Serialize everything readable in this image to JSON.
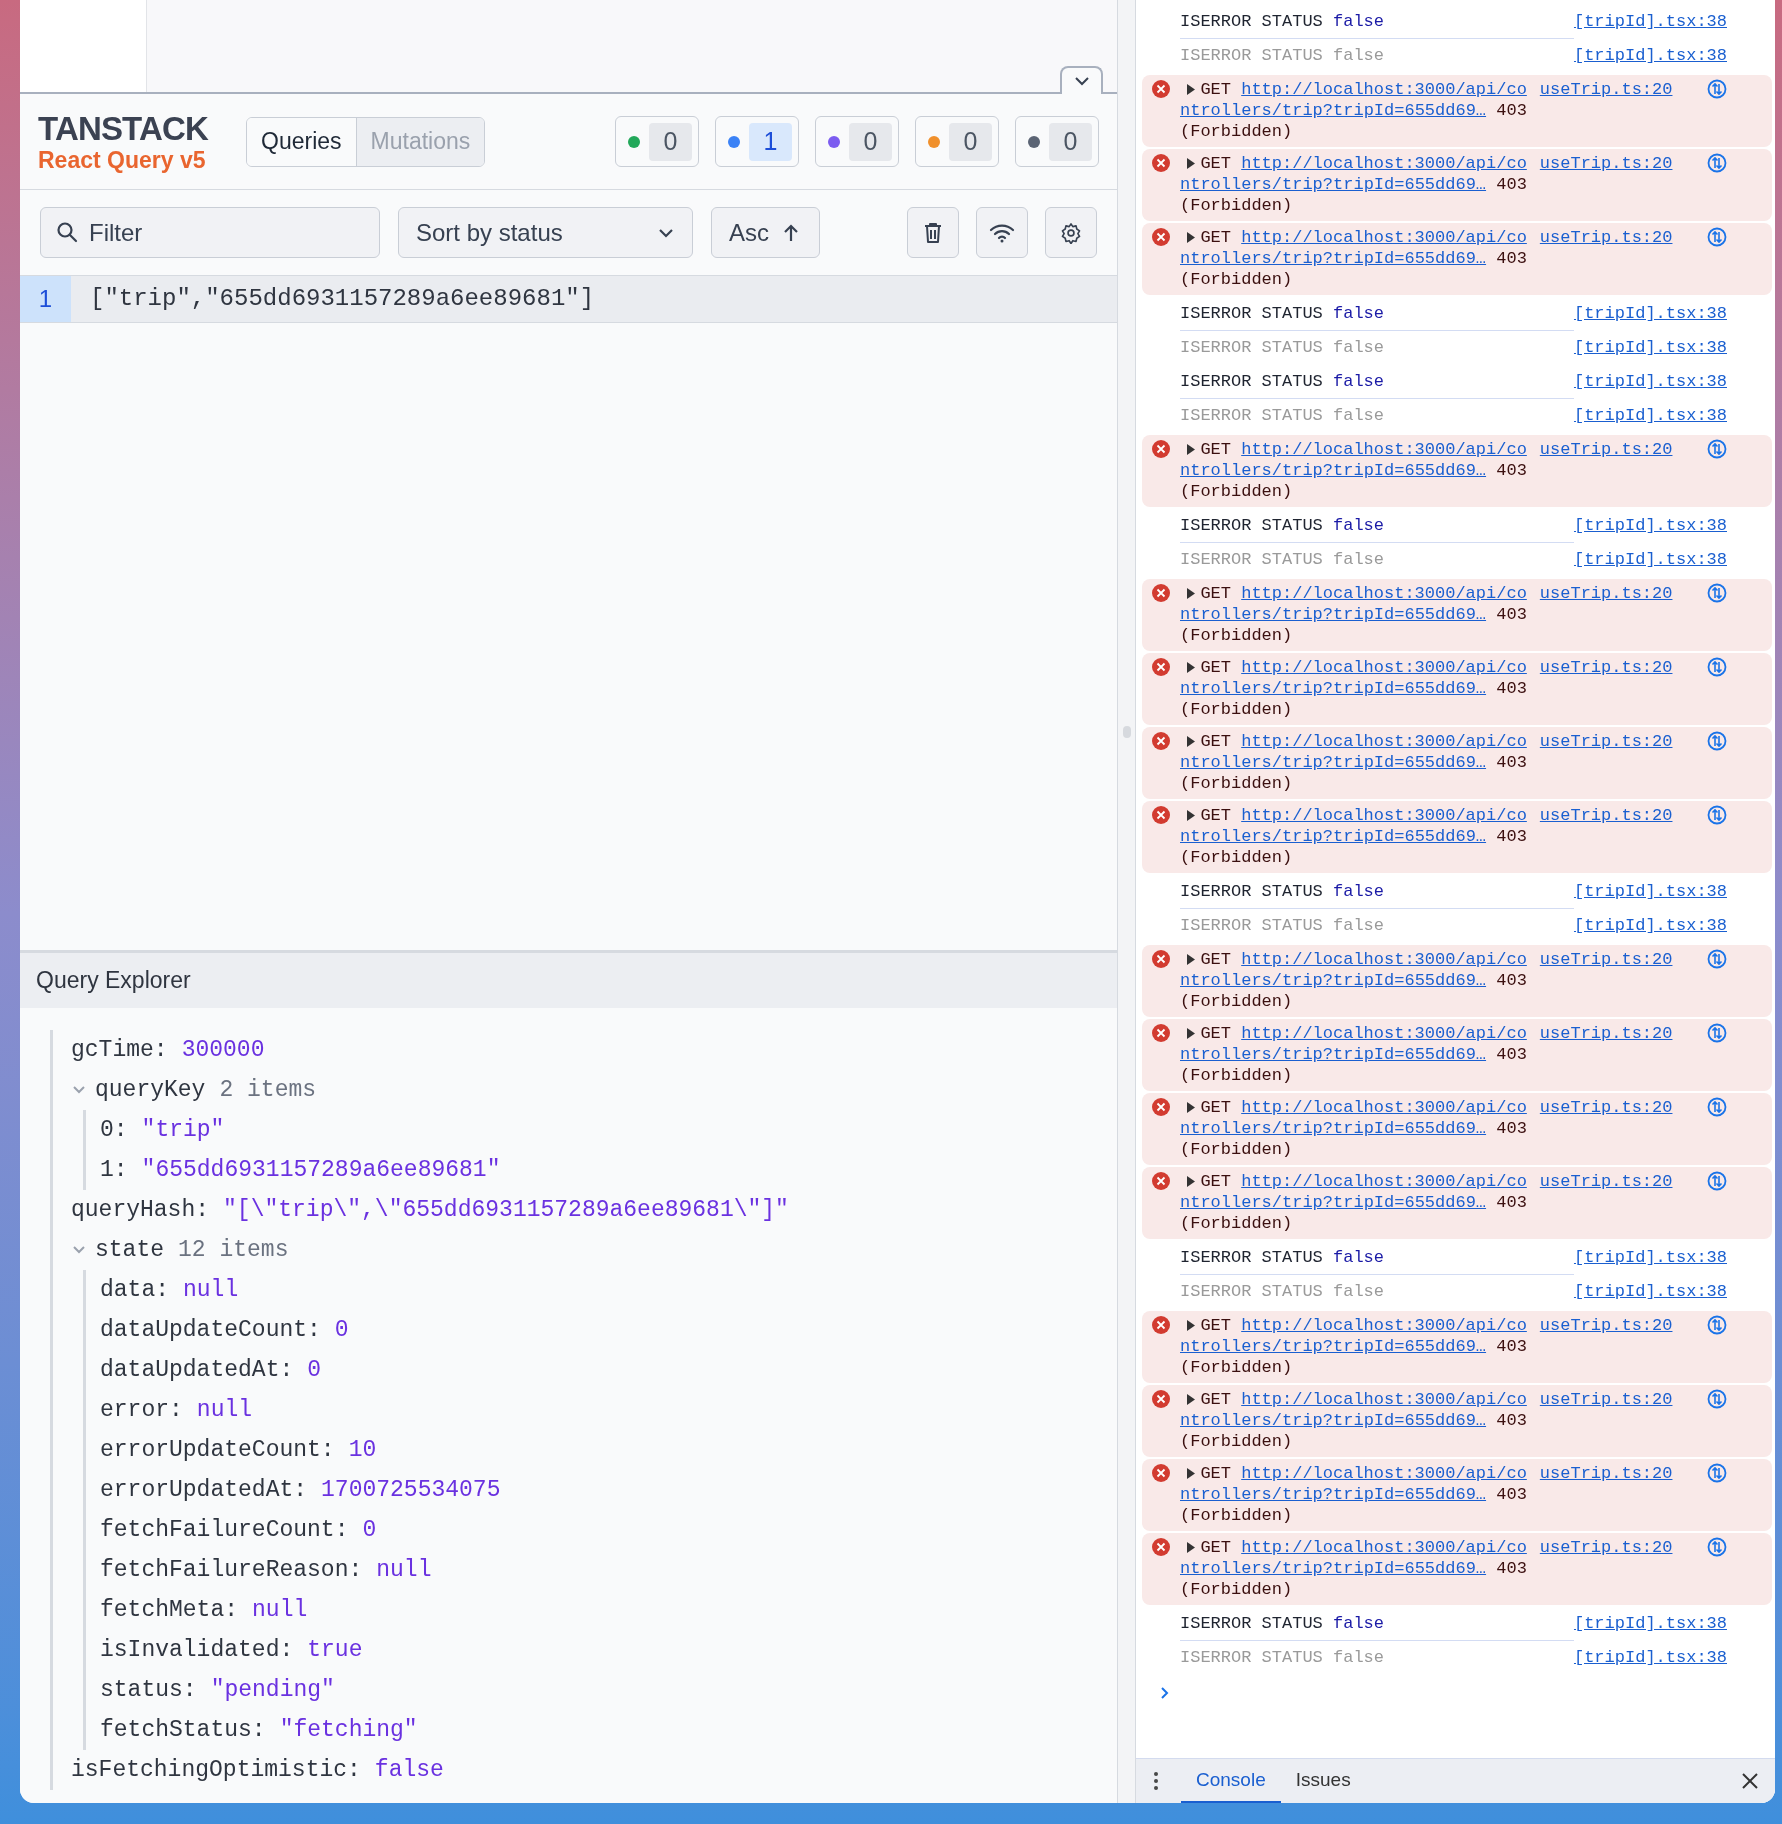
{
  "devtools": {
    "brand": "TANSTACK",
    "subtitle": "React Query v5",
    "tabs": [
      {
        "label": "Queries",
        "selected": true
      },
      {
        "label": "Mutations",
        "selected": false
      }
    ],
    "status_counts": [
      {
        "count": "0",
        "color": "#22a85a",
        "active": false
      },
      {
        "count": "1",
        "color": "#3b82f6",
        "active": true
      },
      {
        "count": "0",
        "color": "#7c5cf0",
        "active": false
      },
      {
        "count": "0",
        "color": "#f0902c",
        "active": false
      },
      {
        "count": "0",
        "color": "#5b6474",
        "active": false
      }
    ],
    "filter": {
      "placeholder": "Filter"
    },
    "sort": {
      "value": "Sort by status"
    },
    "order": {
      "label": "Asc"
    },
    "queries": [
      {
        "index": "1",
        "key": "[\"trip\",\"655dd6931157289a6ee89681\"]",
        "selected": true
      }
    ]
  },
  "query_explorer": {
    "title": "Query Explorer",
    "entries": [
      {
        "key": "gcTime:",
        "value": "300000"
      },
      {
        "key": "queryKey",
        "count": "2 items",
        "expanded": true,
        "children": [
          {
            "key": "0:",
            "value": "\"trip\""
          },
          {
            "key": "1:",
            "value": "\"655dd6931157289a6ee89681\""
          }
        ]
      },
      {
        "key": "queryHash:",
        "value": "\"[\\\"trip\\\",\\\"655dd6931157289a6ee89681\\\"]\""
      },
      {
        "key": "state",
        "count": "12 items",
        "expanded": true,
        "children": [
          {
            "key": "data:",
            "value": "null"
          },
          {
            "key": "dataUpdateCount:",
            "value": "0"
          },
          {
            "key": "dataUpdatedAt:",
            "value": "0"
          },
          {
            "key": "error:",
            "value": "null"
          },
          {
            "key": "errorUpdateCount:",
            "value": "10"
          },
          {
            "key": "errorUpdatedAt:",
            "value": "1700725534075"
          },
          {
            "key": "fetchFailureCount:",
            "value": "0"
          },
          {
            "key": "fetchFailureReason:",
            "value": "null"
          },
          {
            "key": "fetchMeta:",
            "value": "null"
          },
          {
            "key": "isInvalidated:",
            "value": "true"
          },
          {
            "key": "status:",
            "value": "\"pending\""
          },
          {
            "key": "fetchStatus:",
            "value": "\"fetching\""
          }
        ]
      },
      {
        "key": "isFetchingOptimistic:",
        "value": "false"
      }
    ]
  },
  "console": {
    "messages": [
      {
        "kind": "log",
        "text": "ISERROR STATUS",
        "value": "false",
        "dimmed": false,
        "source": "[tripId].tsx:38"
      },
      {
        "kind": "log",
        "text": "ISERROR STATUS",
        "value": "false",
        "dimmed": true,
        "source": "[tripId].tsx:38"
      },
      {
        "kind": "error",
        "method": "GET",
        "url": "http://localhost:3000/api/controllers/trip?tripId=655dd69…",
        "status": "403 (Forbidden)",
        "source": "useTrip.ts:20"
      },
      {
        "kind": "error",
        "method": "GET",
        "url": "http://localhost:3000/api/controllers/trip?tripId=655dd69…",
        "status": "403 (Forbidden)",
        "source": "useTrip.ts:20"
      },
      {
        "kind": "error",
        "method": "GET",
        "url": "http://localhost:3000/api/controllers/trip?tripId=655dd69…",
        "status": "403 (Forbidden)",
        "source": "useTrip.ts:20"
      },
      {
        "kind": "log",
        "text": "ISERROR STATUS",
        "value": "false",
        "dimmed": false,
        "source": "[tripId].tsx:38"
      },
      {
        "kind": "log",
        "text": "ISERROR STATUS",
        "value": "false",
        "dimmed": true,
        "source": "[tripId].tsx:38"
      },
      {
        "kind": "log",
        "text": "ISERROR STATUS",
        "value": "false",
        "dimmed": false,
        "source": "[tripId].tsx:38"
      },
      {
        "kind": "log",
        "text": "ISERROR STATUS",
        "value": "false",
        "dimmed": true,
        "source": "[tripId].tsx:38"
      },
      {
        "kind": "error",
        "method": "GET",
        "url": "http://localhost:3000/api/controllers/trip?tripId=655dd69…",
        "status": "403 (Forbidden)",
        "source": "useTrip.ts:20"
      },
      {
        "kind": "log",
        "text": "ISERROR STATUS",
        "value": "false",
        "dimmed": false,
        "source": "[tripId].tsx:38"
      },
      {
        "kind": "log",
        "text": "ISERROR STATUS",
        "value": "false",
        "dimmed": true,
        "source": "[tripId].tsx:38"
      },
      {
        "kind": "error",
        "method": "GET",
        "url": "http://localhost:3000/api/controllers/trip?tripId=655dd69…",
        "status": "403 (Forbidden)",
        "source": "useTrip.ts:20"
      },
      {
        "kind": "error",
        "method": "GET",
        "url": "http://localhost:3000/api/controllers/trip?tripId=655dd69…",
        "status": "403 (Forbidden)",
        "source": "useTrip.ts:20"
      },
      {
        "kind": "error",
        "method": "GET",
        "url": "http://localhost:3000/api/controllers/trip?tripId=655dd69…",
        "status": "403 (Forbidden)",
        "source": "useTrip.ts:20"
      },
      {
        "kind": "error",
        "method": "GET",
        "url": "http://localhost:3000/api/controllers/trip?tripId=655dd69…",
        "status": "403 (Forbidden)",
        "source": "useTrip.ts:20"
      },
      {
        "kind": "log",
        "text": "ISERROR STATUS",
        "value": "false",
        "dimmed": false,
        "source": "[tripId].tsx:38"
      },
      {
        "kind": "log",
        "text": "ISERROR STATUS",
        "value": "false",
        "dimmed": true,
        "source": "[tripId].tsx:38"
      },
      {
        "kind": "error",
        "method": "GET",
        "url": "http://localhost:3000/api/controllers/trip?tripId=655dd69…",
        "status": "403 (Forbidden)",
        "source": "useTrip.ts:20"
      },
      {
        "kind": "error",
        "method": "GET",
        "url": "http://localhost:3000/api/controllers/trip?tripId=655dd69…",
        "status": "403 (Forbidden)",
        "source": "useTrip.ts:20"
      },
      {
        "kind": "error",
        "method": "GET",
        "url": "http://localhost:3000/api/controllers/trip?tripId=655dd69…",
        "status": "403 (Forbidden)",
        "source": "useTrip.ts:20"
      },
      {
        "kind": "error",
        "method": "GET",
        "url": "http://localhost:3000/api/controllers/trip?tripId=655dd69…",
        "status": "403 (Forbidden)",
        "source": "useTrip.ts:20"
      },
      {
        "kind": "log",
        "text": "ISERROR STATUS",
        "value": "false",
        "dimmed": false,
        "source": "[tripId].tsx:38"
      },
      {
        "kind": "log",
        "text": "ISERROR STATUS",
        "value": "false",
        "dimmed": true,
        "source": "[tripId].tsx:38"
      },
      {
        "kind": "error",
        "method": "GET",
        "url": "http://localhost:3000/api/controllers/trip?tripId=655dd69…",
        "status": "403 (Forbidden)",
        "source": "useTrip.ts:20"
      },
      {
        "kind": "error",
        "method": "GET",
        "url": "http://localhost:3000/api/controllers/trip?tripId=655dd69…",
        "status": "403 (Forbidden)",
        "source": "useTrip.ts:20"
      },
      {
        "kind": "error",
        "method": "GET",
        "url": "http://localhost:3000/api/controllers/trip?tripId=655dd69…",
        "status": "403 (Forbidden)",
        "source": "useTrip.ts:20"
      },
      {
        "kind": "error",
        "method": "GET",
        "url": "http://localhost:3000/api/controllers/trip?tripId=655dd69…",
        "status": "403 (Forbidden)",
        "source": "useTrip.ts:20"
      },
      {
        "kind": "log",
        "text": "ISERROR STATUS",
        "value": "false",
        "dimmed": false,
        "source": "[tripId].tsx:38"
      },
      {
        "kind": "log",
        "text": "ISERROR STATUS",
        "value": "false",
        "dimmed": true,
        "source": "[tripId].tsx:38"
      }
    ],
    "tabs": [
      {
        "label": "Console",
        "selected": true
      },
      {
        "label": "Issues",
        "selected": false
      }
    ]
  }
}
